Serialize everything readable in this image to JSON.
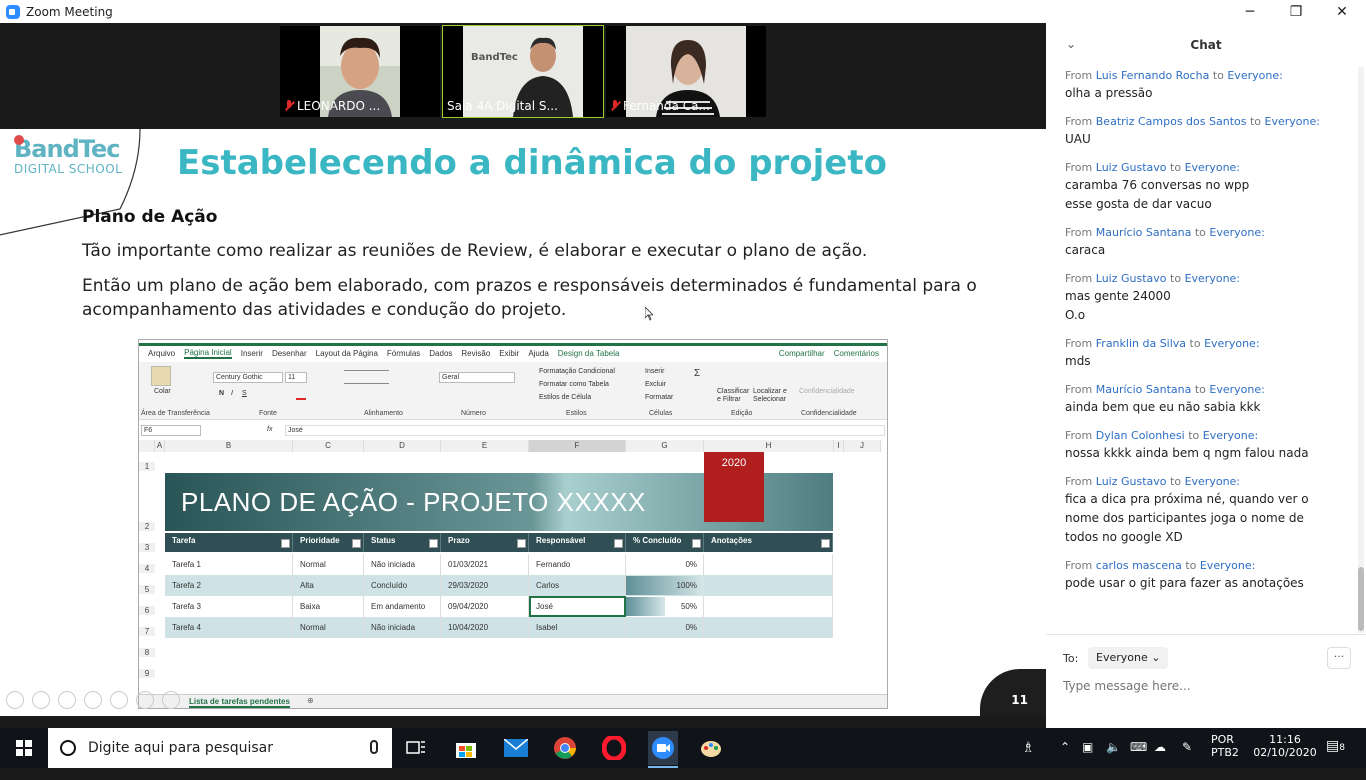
{
  "window": {
    "title": "Zoom Meeting",
    "minimize": "─",
    "restore": "❐",
    "close": "✕"
  },
  "participants": [
    {
      "name": "LEONARDO ...",
      "muted": true
    },
    {
      "name": "Sala 4A Digital S...",
      "muted": false
    },
    {
      "name": "Fernanda Ca...",
      "muted": true
    }
  ],
  "slide": {
    "logo_brand": "BandTec",
    "logo_sub": "DIGITAL SCHOOL",
    "title": "Estabelecendo a dinâmica do projeto",
    "subtitle": "Plano de Ação",
    "para1": "Tão importante como realizar as reuniões de Review, é elaborar e executar o plano de ação.",
    "para2": "Então um plano de ação bem elaborado, com prazos e responsáveis determinados é fundamental para o acompanhamento das atividades e condução do projeto.",
    "page_number": "11"
  },
  "excel": {
    "tabs": [
      "Arquivo",
      "Página Inicial",
      "Inserir",
      "Desenhar",
      "Layout da Página",
      "Fórmulas",
      "Dados",
      "Revisão",
      "Exibir",
      "Ajuda",
      "Design da Tabela"
    ],
    "share": "Compartilhar",
    "comments": "Comentários",
    "groups": [
      "Área de Transferência",
      "Fonte",
      "Alinhamento",
      "Número",
      "Estilos",
      "Células",
      "Edição",
      "Confidencialidade"
    ],
    "font_name": "Century Gothic",
    "font_size": "11",
    "number_format": "Geral",
    "paste": "Colar",
    "styles": [
      "Formatação Condicional",
      "Formatar como Tabela",
      "Estilos de Célula"
    ],
    "cells": [
      "Inserir",
      "Excluir",
      "Formatar"
    ],
    "editing": [
      "Classificar e Filtrar",
      "Localizar e Selecionar"
    ],
    "confidential": "Confidencialidade",
    "name_box": "F6",
    "fx": "fx",
    "formula": "José",
    "columns": [
      "A",
      "B",
      "C",
      "D",
      "E",
      "F",
      "G",
      "H",
      "I",
      "J"
    ],
    "rows": [
      "1",
      "2",
      "3",
      "4",
      "5",
      "6",
      "7",
      "8",
      "9"
    ],
    "banner": "PLANO DE AÇÃO - PROJETO XXXXX",
    "year": "2020",
    "headers": [
      "Tarefa",
      "Prioridade",
      "Status",
      "Prazo",
      "Responsável",
      "% Concluído",
      "Anotações"
    ],
    "table": [
      {
        "tarefa": "Tarefa 1",
        "prioridade": "Normal",
        "status": "Não iniciada",
        "prazo": "01/03/2021",
        "responsavel": "Fernando",
        "pct": "0%",
        "pct_value": 0
      },
      {
        "tarefa": "Tarefa 2",
        "prioridade": "Alta",
        "status": "Concluído",
        "prazo": "29/03/2020",
        "responsavel": "Carlos",
        "pct": "100%",
        "pct_value": 100
      },
      {
        "tarefa": "Tarefa 3",
        "prioridade": "Baixa",
        "status": "Em andamento",
        "prazo": "09/04/2020",
        "responsavel": "José",
        "pct": "50%",
        "pct_value": 50
      },
      {
        "tarefa": "Tarefa 4",
        "prioridade": "Normal",
        "status": "Não iniciada",
        "prazo": "10/04/2020",
        "responsavel": "Isabel",
        "pct": "0%",
        "pct_value": 0
      }
    ],
    "sheet_tab": "Lista de tarefas pendentes"
  },
  "chat": {
    "title": "Chat",
    "messages": [
      {
        "from": "Luis Fernando Rocha",
        "to": "Everyone:",
        "lines": [
          "olha a pressão"
        ]
      },
      {
        "from": "Beatriz Campos dos Santos",
        "to": "Everyone:",
        "lines": [
          "UAU"
        ]
      },
      {
        "from": "Luiz Gustavo",
        "to": "Everyone:",
        "lines": [
          "caramba 76 conversas no wpp",
          "esse gosta de dar vacuo"
        ]
      },
      {
        "from": "Maurício Santana",
        "to": "Everyone:",
        "lines": [
          "caraca"
        ]
      },
      {
        "from": "Luiz Gustavo",
        "to": "Everyone:",
        "lines": [
          "mas gente 24000",
          "O.o"
        ]
      },
      {
        "from": "Franklin da Silva",
        "to": "Everyone:",
        "lines": [
          "mds"
        ]
      },
      {
        "from": "Maurício Santana",
        "to": "Everyone:",
        "lines": [
          "ainda bem que eu não sabia kkk"
        ]
      },
      {
        "from": "Dylan Colonhesi",
        "to": "Everyone:",
        "lines": [
          "nossa kkkk ainda bem q ngm falou nada"
        ]
      },
      {
        "from": "Luiz Gustavo",
        "to": "Everyone:",
        "lines": [
          "fica a dica pra próxima né, quando ver o",
          "nome dos participantes joga o nome de",
          "todos no google XD"
        ]
      },
      {
        "from": "carlos mascena",
        "to": "Everyone:",
        "lines": [
          "pode usar o git para fazer as anotações"
        ]
      }
    ],
    "from_word": "From",
    "to_word": "to",
    "to_label": "To:",
    "recipient": "Everyone",
    "more": "···",
    "placeholder": "Type message here..."
  },
  "taskbar": {
    "search_placeholder": "Digite aqui para pesquisar",
    "lang1": "POR",
    "lang2": "PTB2",
    "time": "11:16",
    "date": "02/10/2020",
    "notifications": "8"
  },
  "colors": {
    "zoom_blue": "#2d8cff",
    "slide_title": "#3bb7c4",
    "excel_green": "#217346",
    "chat_name": "#2d6ec4",
    "year_red": "#b01e1e"
  }
}
